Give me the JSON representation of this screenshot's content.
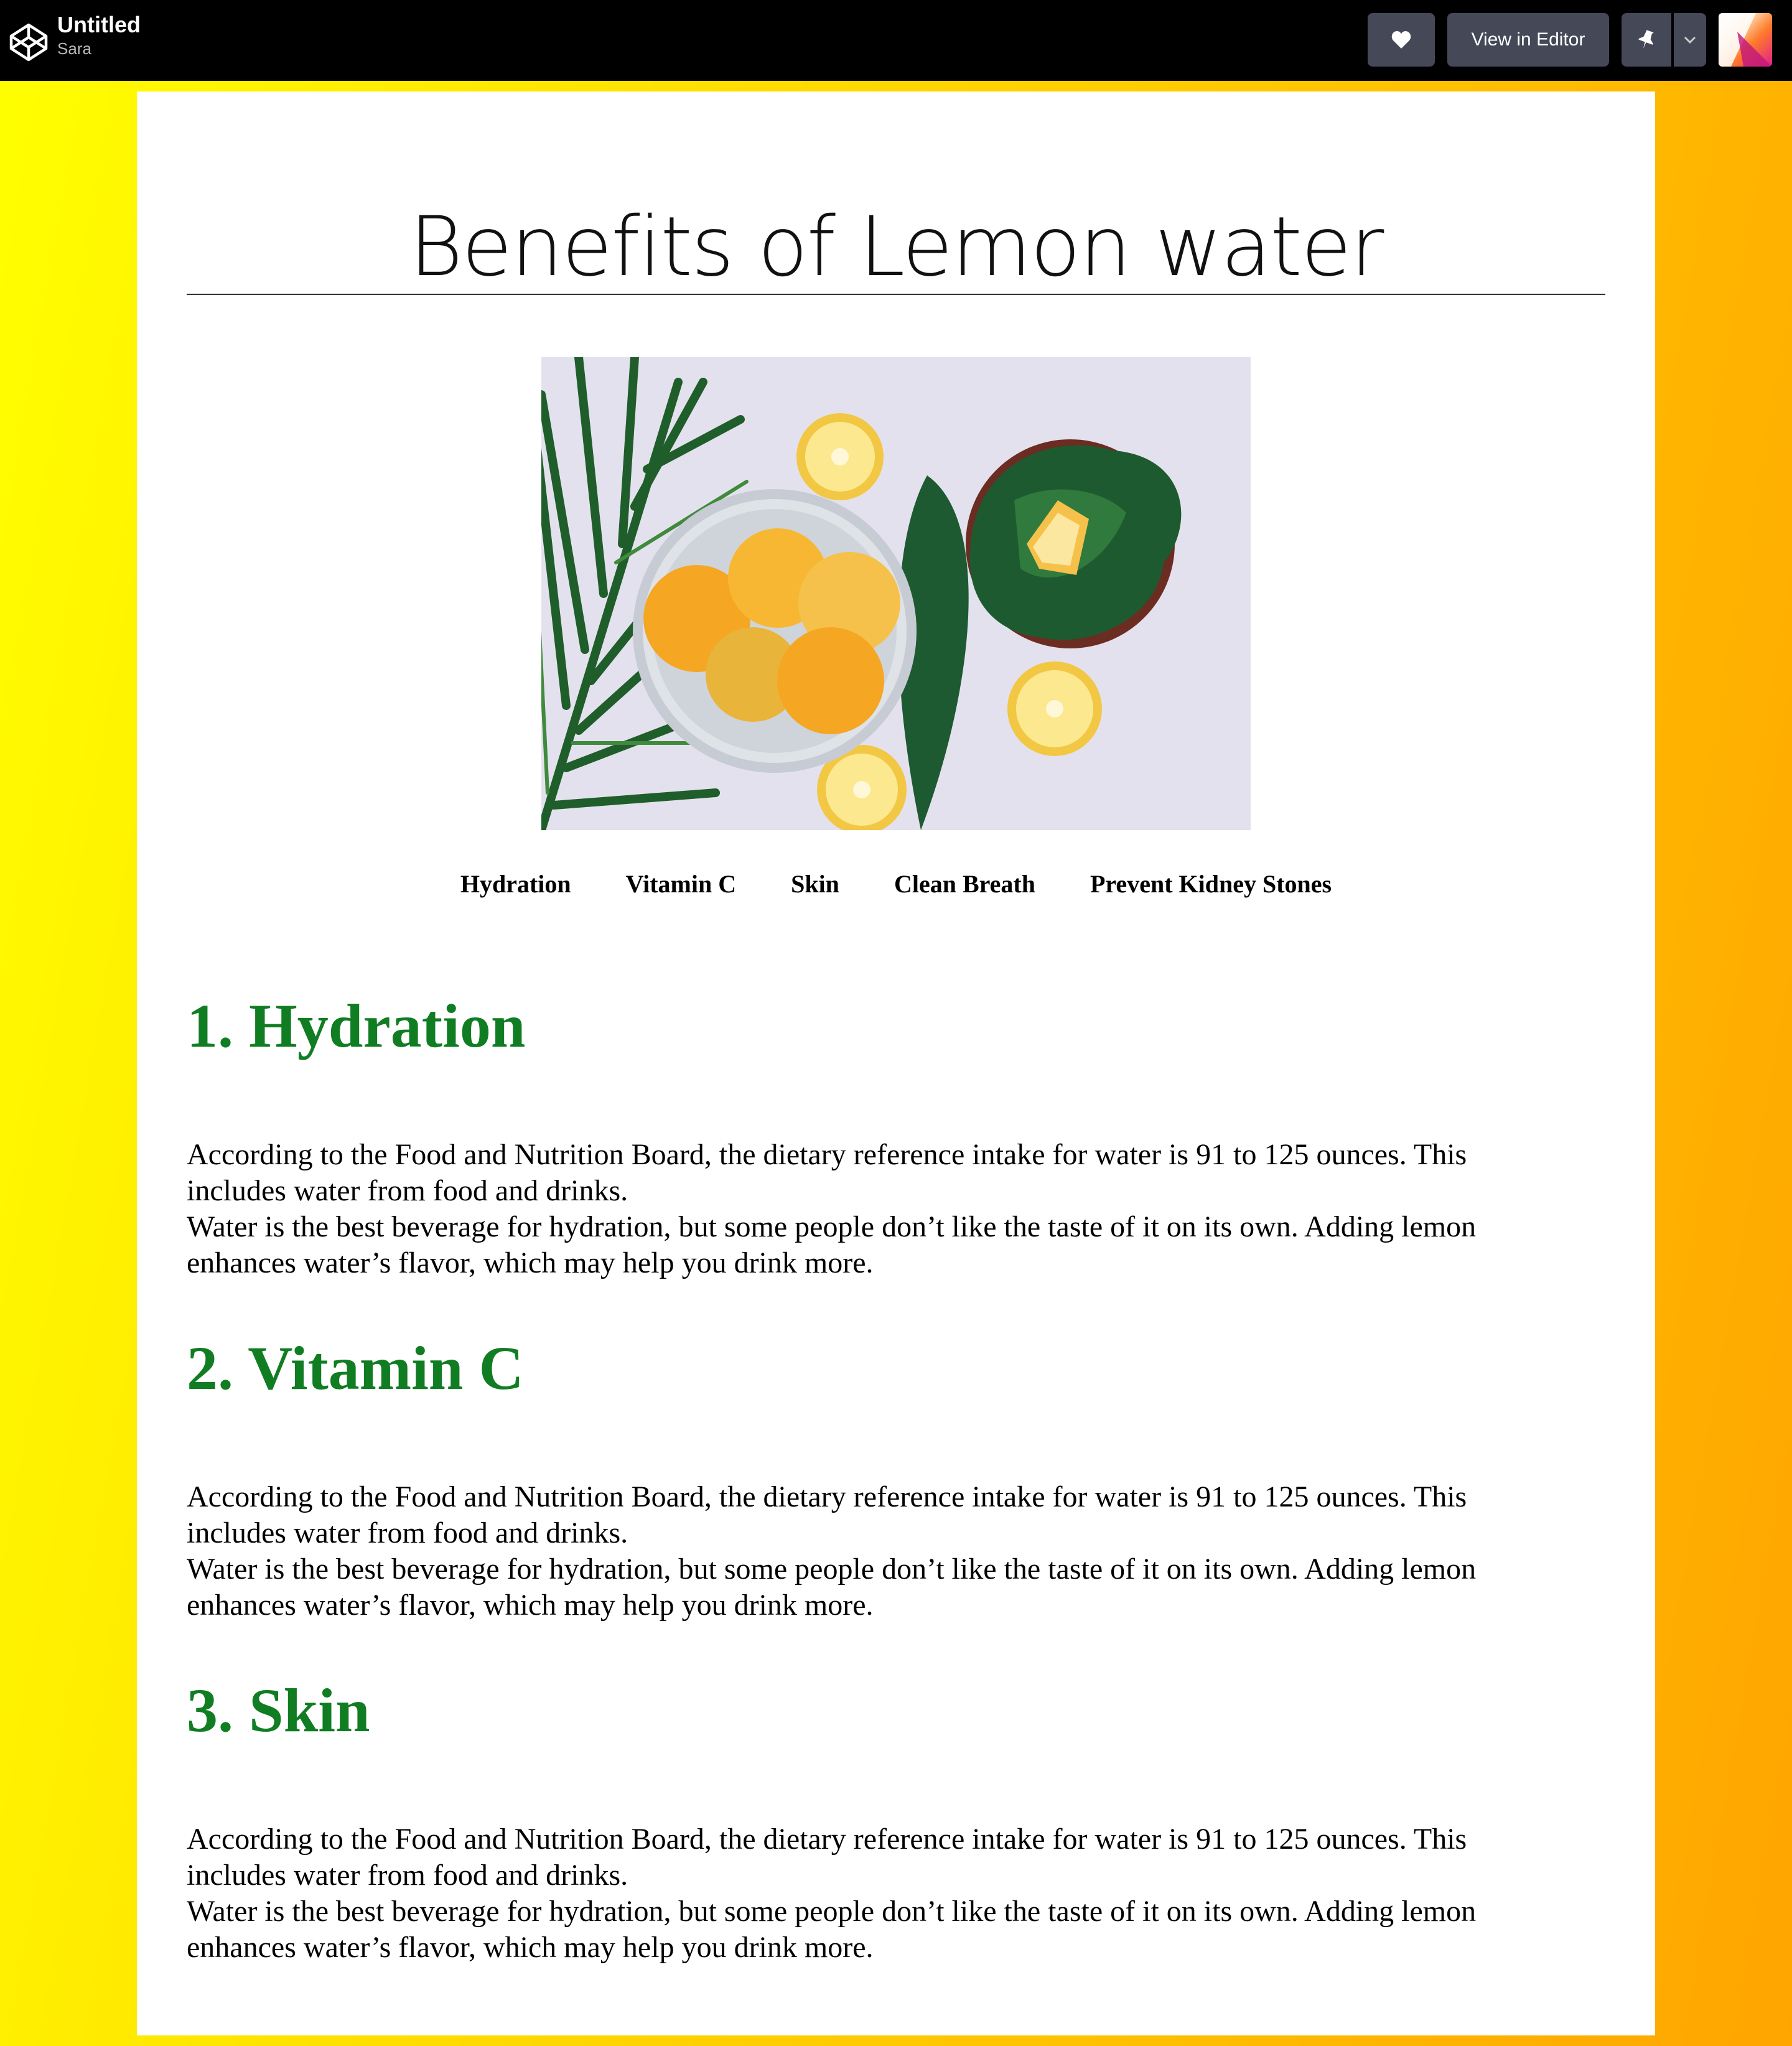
{
  "header": {
    "pen_title": "Untitled",
    "author": "Sara",
    "logo_icon": "codepen-logo-icon",
    "heart_icon": "heart-icon",
    "view_editor_label": "View in Editor",
    "pin_icon": "pin-icon",
    "dropdown_icon": "chevron-down-icon"
  },
  "page": {
    "title": "Benefits of Lemon water",
    "image_alt": "Lemons in a bowl with leaves",
    "nav": [
      "Hydration",
      "Vitamin C",
      "Skin",
      "Clean Breath",
      "Prevent Kidney Stones"
    ],
    "sections": [
      {
        "heading": "1. Hydration",
        "line1": "According to the Food and Nutrition Board, the dietary reference intake for water is 91 to 125 ounces. This includes water from food and drinks.",
        "line2": "Water is the best beverage for hydration, but some people don’t like the taste of it on its own. Adding lemon enhances water’s flavor, which may help you drink more."
      },
      {
        "heading": "2. Vitamin C",
        "line1": "According to the Food and Nutrition Board, the dietary reference intake for water is 91 to 125 ounces. This includes water from food and drinks.",
        "line2": "Water is the best beverage for hydration, but some people don’t like the taste of it on its own. Adding lemon enhances water’s flavor, which may help you drink more."
      },
      {
        "heading": "3. Skin",
        "line1": "According to the Food and Nutrition Board, the dietary reference intake for water is 91 to 125 ounces. This includes water from food and drinks.",
        "line2": "Water is the best beverage for hydration, but some people don’t like the taste of it on its own. Adding lemon enhances water’s flavor, which may help you drink more."
      }
    ]
  },
  "colors": {
    "heading_green": "#117d23",
    "topbar": "#000000",
    "button": "#444857",
    "gradient_start": "#ffff00",
    "gradient_end": "#ffa500"
  }
}
